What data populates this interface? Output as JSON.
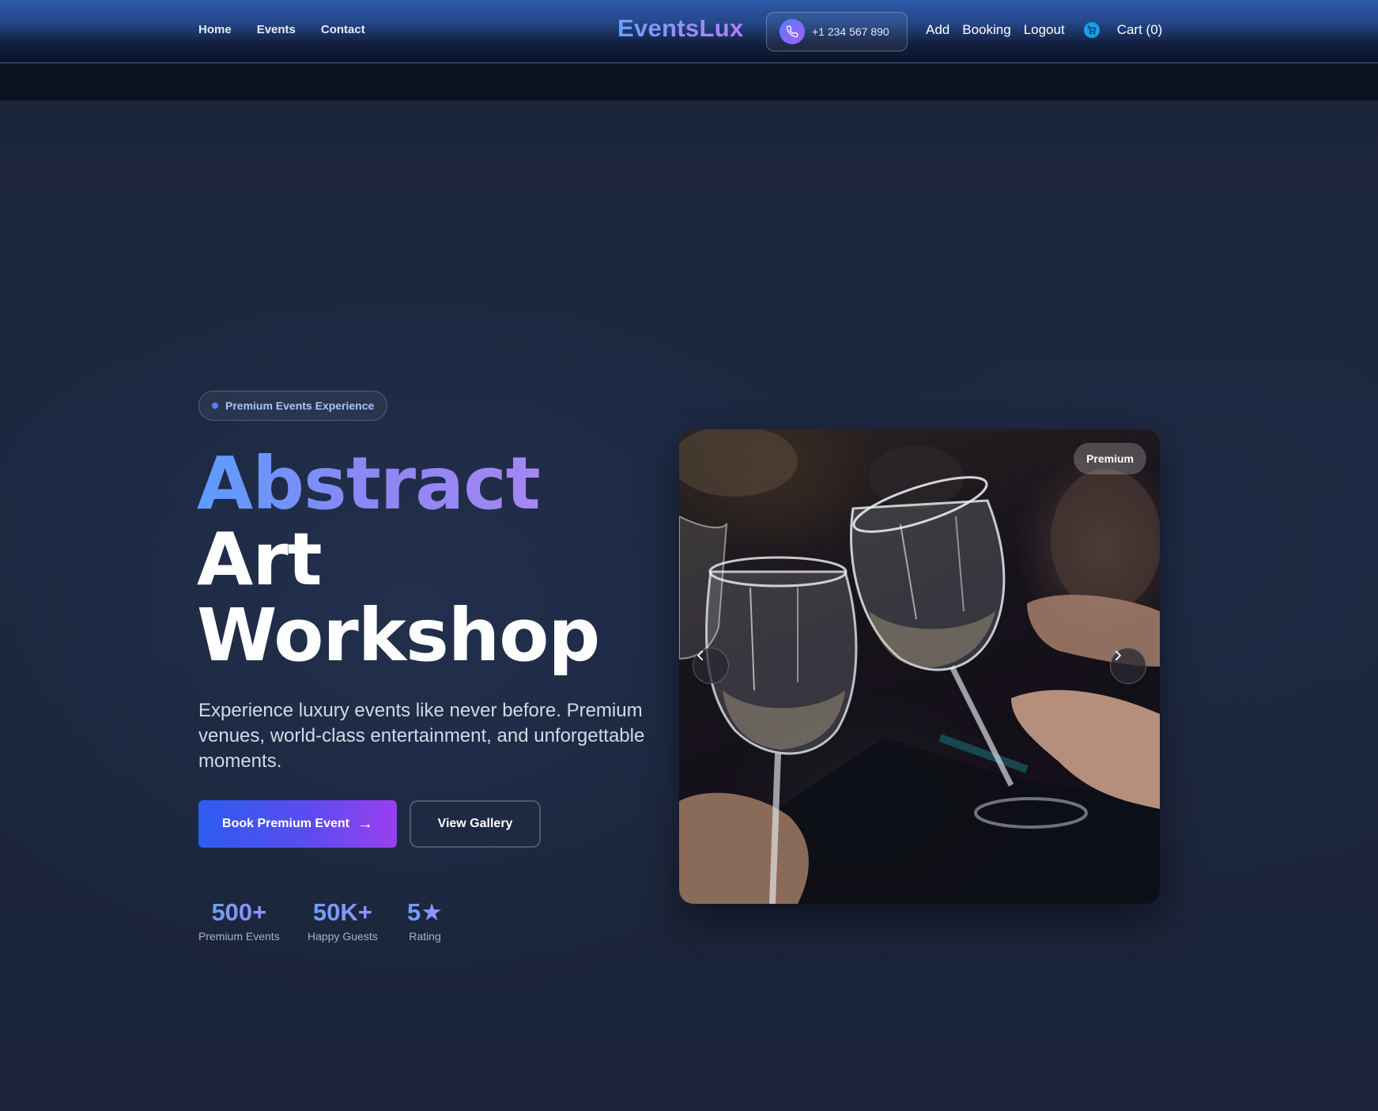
{
  "header": {
    "nav_left": [
      "Home",
      "Events",
      "Contact"
    ],
    "logo": "EventsLux",
    "phone": "+1 234 567 890",
    "nav_right": {
      "add": "Add",
      "booking": "Booking",
      "logout": "Logout",
      "cart": "Cart (0)"
    }
  },
  "hero": {
    "badge": "Premium Events Experience",
    "title_line1": "Abstract",
    "title_line2": "Art",
    "title_line3": "Workshop",
    "description": "Experience luxury events like never before. Premium venues, world-class entertainment, and unforgettable moments.",
    "primary_button": "Book Premium Event",
    "primary_button_arrow": "→",
    "secondary_button": "View Gallery",
    "stats": [
      {
        "value": "500+",
        "label": "Premium Events"
      },
      {
        "value": "50K+",
        "label": "Happy Guests"
      },
      {
        "value": "5★",
        "label": "Rating"
      }
    ]
  },
  "carousel": {
    "tag": "Premium",
    "image_icon": "wine-glasses-toast-photo",
    "prev_icon": "chevron-left-icon",
    "next_icon": "chevron-right-icon"
  },
  "colors": {
    "accent_blue": "#4f80ff",
    "accent_purple": "#9a3ff0",
    "cart_icon": "#16a0e8"
  }
}
